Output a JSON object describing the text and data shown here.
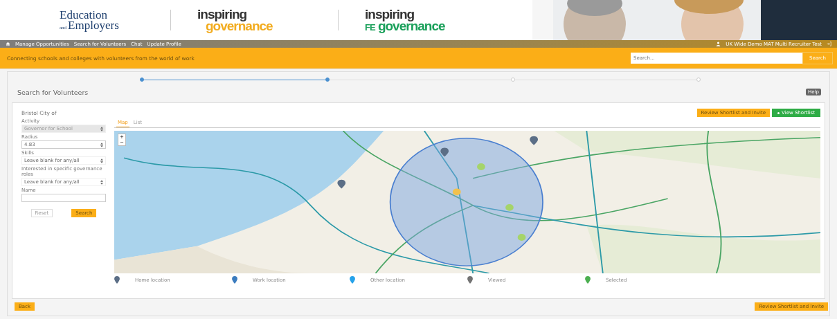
{
  "header": {
    "logos": [
      {
        "kind": "ee",
        "line1": "Education",
        "small": "and",
        "line2": "Employers"
      },
      {
        "kind": "ig",
        "top": "inspiring",
        "bottom": "governance"
      },
      {
        "kind": "fe",
        "top": "inspiring",
        "prefix": "FE",
        "bottom": "governance"
      }
    ]
  },
  "nav": {
    "items": [
      "Manage Opportunities",
      "Search for Volunteers",
      "Chat",
      "Update Profile"
    ],
    "user": "UK Wide Demo MAT Multi Recruiter Test"
  },
  "banner": {
    "tagline": "Connecting schools and colleges with volunteers from the world of work",
    "search": {
      "placeholder": "Search..."
    },
    "search_button": "Search"
  },
  "stepper": [
    {
      "active": true
    },
    {
      "active": true
    },
    {
      "active": false
    },
    {
      "active": false
    }
  ],
  "page": {
    "title": "Search for Volunteers",
    "help": "Help"
  },
  "form": {
    "location": "Bristol City of",
    "fields": [
      {
        "kind": "select",
        "label": "Activity",
        "value": "Governor for School",
        "disabled": true
      },
      {
        "kind": "number",
        "label": "Radius",
        "value": "4.83",
        "disabled": false
      },
      {
        "kind": "select",
        "label": "Skills",
        "value": "Leave blank for any/all",
        "disabled": false
      },
      {
        "kind": "select",
        "label": "Interested in specific governance roles",
        "value": "Leave blank for any/all",
        "disabled": false
      },
      {
        "kind": "text",
        "label": "Name",
        "disabled": false
      }
    ],
    "reset": "Reset",
    "search": "Search"
  },
  "map_panel": {
    "review_button": "Review Shortlist and Invite",
    "view_button": "View Shortlist",
    "tabs": [
      {
        "label": "Map",
        "selected": true
      },
      {
        "label": "List",
        "selected": false
      }
    ],
    "zoom_in": "+",
    "zoom_out": "−",
    "legend": [
      {
        "label": "Home location",
        "color": "#5b6e86"
      },
      {
        "label": "Work location",
        "color": "#3b7cbf"
      },
      {
        "label": "Other location",
        "color": "#25a2ea"
      },
      {
        "label": "Viewed",
        "color": "#737373"
      },
      {
        "label": "Selected",
        "color": "#4caf50"
      }
    ]
  },
  "footer": {
    "back": "Back",
    "review_button": "Review Shortlist and Invite"
  }
}
